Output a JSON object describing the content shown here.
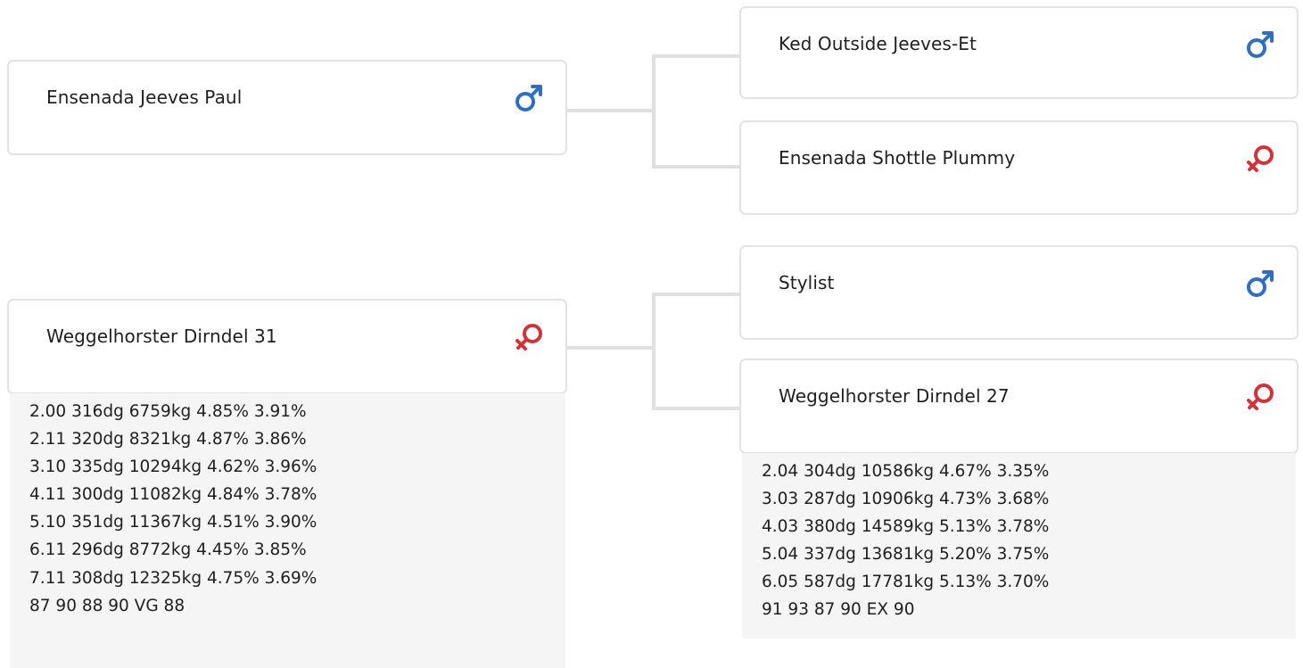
{
  "colors": {
    "male": "#2f6fbd",
    "female": "#d23339",
    "card_border": "#e3e3e3",
    "connector": "#e0e0e0",
    "stats_bg": "#f5f5f5"
  },
  "animals": {
    "sire": {
      "name": "Ensenada Jeeves Paul",
      "sex": "male",
      "icon": "male-symbol-icon"
    },
    "sire_sire": {
      "name": "Ked Outside Jeeves-Et",
      "sex": "male",
      "icon": "male-symbol-icon"
    },
    "sire_dam": {
      "name": "Ensenada Shottle Plummy",
      "sex": "female",
      "icon": "female-symbol-icon"
    },
    "dam": {
      "name": "Weggelhorster Dirndel 31",
      "sex": "female",
      "icon": "female-symbol-icon",
      "stats": [
        "2.00 316dg 6759kg 4.85% 3.91%",
        "2.11 320dg 8321kg 4.87% 3.86%",
        "3.10 335dg 10294kg 4.62% 3.96%",
        "4.11 300dg 11082kg 4.84% 3.78%",
        "5.10 351dg 11367kg 4.51% 3.90%",
        "6.11 296dg 8772kg 4.45% 3.85%",
        "7.11 308dg 12325kg 4.75% 3.69%",
        "87 90 88 90 VG 88"
      ]
    },
    "dam_sire": {
      "name": "Stylist",
      "sex": "male",
      "icon": "male-symbol-icon"
    },
    "dam_dam": {
      "name": "Weggelhorster Dirndel 27",
      "sex": "female",
      "icon": "female-symbol-icon",
      "stats": [
        "2.04 304dg 10586kg 4.67% 3.35%",
        "3.03 287dg 10906kg 4.73% 3.68%",
        "4.03 380dg 14589kg 5.13% 3.78%",
        "5.04 337dg 13681kg 5.20% 3.75%",
        "6.05 587dg 17781kg 5.13% 3.70%",
        "91 93 87 90 EX 90"
      ]
    }
  }
}
